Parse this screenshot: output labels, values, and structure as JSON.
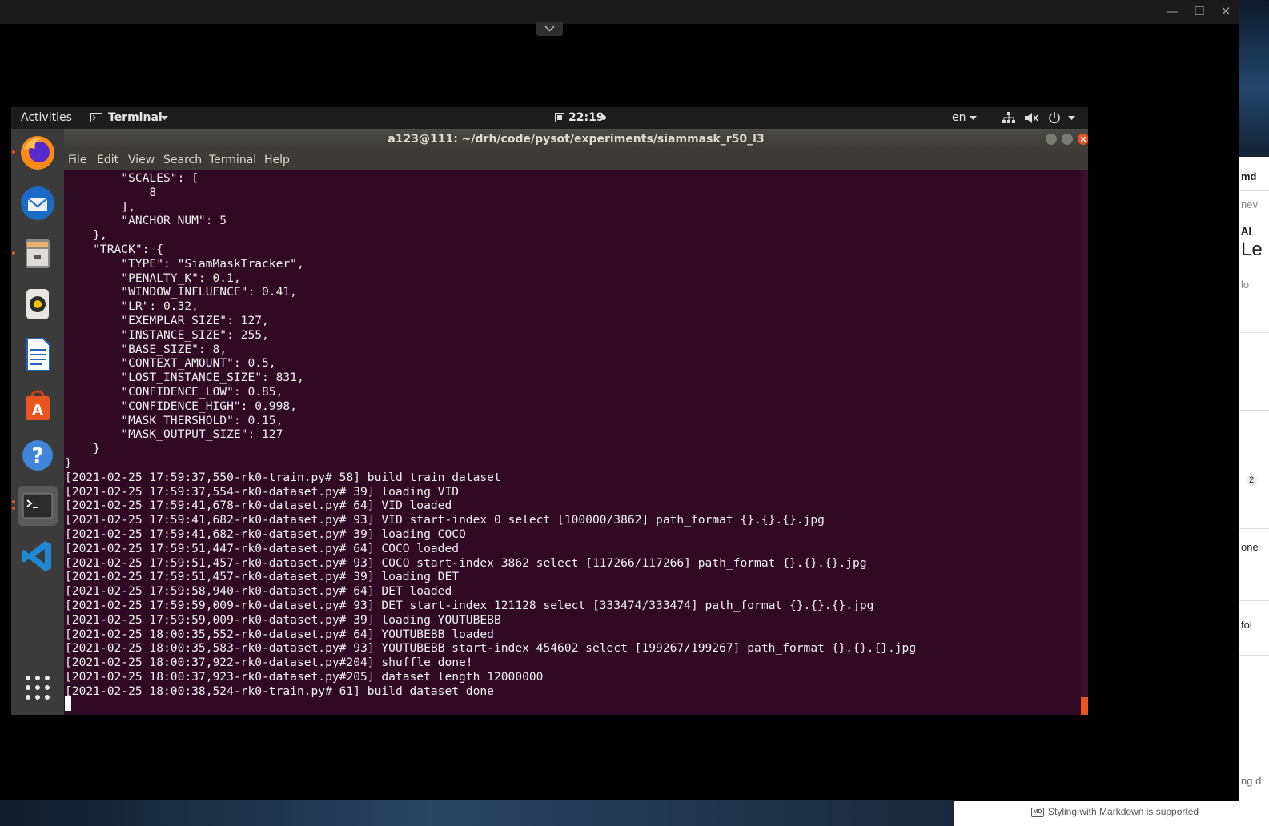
{
  "viewer": {
    "minimize_glyph": "—",
    "maximize_glyph": "☐",
    "close_glyph": "✕"
  },
  "topbar": {
    "activities": "Activities",
    "app_menu": "Terminal",
    "clock": "22:19",
    "language": "en"
  },
  "terminal": {
    "title": "a123@111: ~/drh/code/pysot/experiments/siammask_r50_l3",
    "menu": [
      "File",
      "Edit",
      "View",
      "Search",
      "Terminal",
      "Help"
    ],
    "lines": [
      "        \"SCALES\": [",
      "            8",
      "        ],",
      "        \"ANCHOR_NUM\": 5",
      "    },",
      "    \"TRACK\": {",
      "        \"TYPE\": \"SiamMaskTracker\",",
      "        \"PENALTY_K\": 0.1,",
      "        \"WINDOW_INFLUENCE\": 0.41,",
      "        \"LR\": 0.32,",
      "        \"EXEMPLAR_SIZE\": 127,",
      "        \"INSTANCE_SIZE\": 255,",
      "        \"BASE_SIZE\": 8,",
      "        \"CONTEXT_AMOUNT\": 0.5,",
      "        \"LOST_INSTANCE_SIZE\": 831,",
      "        \"CONFIDENCE_LOW\": 0.85,",
      "        \"CONFIDENCE_HIGH\": 0.998,",
      "        \"MASK_THERSHOLD\": 0.15,",
      "        \"MASK_OUTPUT_SIZE\": 127",
      "    }",
      "}",
      "[2021-02-25 17:59:37,550-rk0-train.py# 58] build train dataset",
      "[2021-02-25 17:59:37,554-rk0-dataset.py# 39] loading VID",
      "[2021-02-25 17:59:41,678-rk0-dataset.py# 64] VID loaded",
      "[2021-02-25 17:59:41,682-rk0-dataset.py# 93] VID start-index 0 select [100000/3862] path_format {}.{}.{}.jpg",
      "[2021-02-25 17:59:41,682-rk0-dataset.py# 39] loading COCO",
      "[2021-02-25 17:59:51,447-rk0-dataset.py# 64] COCO loaded",
      "[2021-02-25 17:59:51,457-rk0-dataset.py# 93] COCO start-index 3862 select [117266/117266] path_format {}.{}.{}.jpg",
      "[2021-02-25 17:59:51,457-rk0-dataset.py# 39] loading DET",
      "[2021-02-25 17:59:58,940-rk0-dataset.py# 64] DET loaded",
      "[2021-02-25 17:59:59,009-rk0-dataset.py# 93] DET start-index 121128 select [333474/333474] path_format {}.{}.{}.jpg",
      "[2021-02-25 17:59:59,009-rk0-dataset.py# 39] loading YOUTUBEBB",
      "[2021-02-25 18:00:35,552-rk0-dataset.py# 64] YOUTUBEBB loaded",
      "[2021-02-25 18:00:35,583-rk0-dataset.py# 93] YOUTUBEBB start-index 454602 select [199267/199267] path_format {}.{}.{}.jpg",
      "[2021-02-25 18:00:37,922-rk0-dataset.py#204] shuffle done!",
      "[2021-02-25 18:00:37,923-rk0-dataset.py#205] dataset length 12000000",
      "[2021-02-25 18:00:38,524-rk0-train.py# 61] build dataset done"
    ]
  },
  "background_window": {
    "fragments": [
      "md",
      "nev",
      "Al",
      "Le",
      "lo",
      "2",
      "one",
      "fol",
      "ng d"
    ]
  },
  "footer": {
    "markdown_badge": "MD",
    "markdown_hint": "Styling with Markdown is supported"
  },
  "colors": {
    "terminal_bg": "#300a24",
    "ubuntu_orange": "#e95420",
    "panel_bg": "#1d1d1d"
  }
}
